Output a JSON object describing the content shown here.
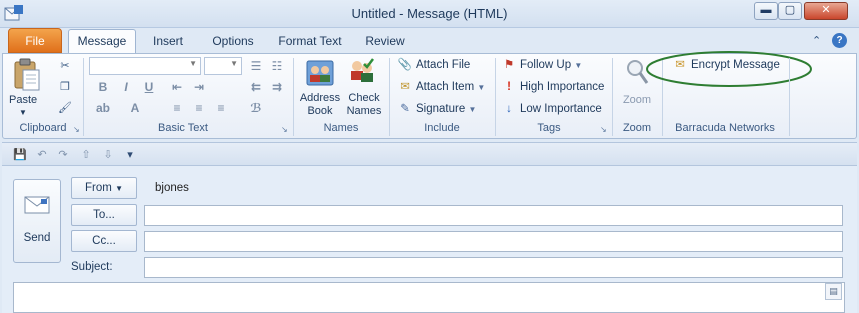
{
  "window": {
    "title": "Untitled  -  Message (HTML)",
    "minimize_glyph": "▬",
    "maximize_glyph": "▢",
    "close_glyph": "✕"
  },
  "tabs": {
    "file": "File",
    "items": [
      "Message",
      "Insert",
      "Options",
      "Format Text",
      "Review"
    ],
    "active": "Message"
  },
  "ribbon": {
    "clipboard": {
      "paste_label": "Paste",
      "group_label": "Clipboard"
    },
    "basic_text": {
      "font_name": "",
      "font_size": "",
      "bold": "B",
      "italic": "I",
      "underline": "U",
      "group_label": "Basic Text"
    },
    "names": {
      "address_book_label": "Address\nBook",
      "check_names_label": "Check\nNames",
      "group_label": "Names"
    },
    "include": {
      "attach_file": "Attach File",
      "attach_item": "Attach Item",
      "signature": "Signature",
      "group_label": "Include"
    },
    "tags": {
      "follow_up": "Follow Up",
      "high_importance": "High Importance",
      "low_importance": "Low Importance",
      "group_label": "Tags"
    },
    "zoom": {
      "zoom_label": "Zoom",
      "group_label": "Zoom"
    },
    "barracuda": {
      "encrypt_message": "Encrypt Message",
      "group_label": "Barracuda Networks"
    }
  },
  "compose": {
    "send_label": "Send",
    "from_button": "From",
    "from_value": "bjones",
    "to_button": "To...",
    "cc_button": "Cc...",
    "subject_label": "Subject:",
    "to_value": "",
    "cc_value": "",
    "subject_value": ""
  },
  "colors": {
    "file_tab": "#e0701b",
    "encrypt_highlight": "#2e7d32",
    "close_button": "#c9462c"
  }
}
